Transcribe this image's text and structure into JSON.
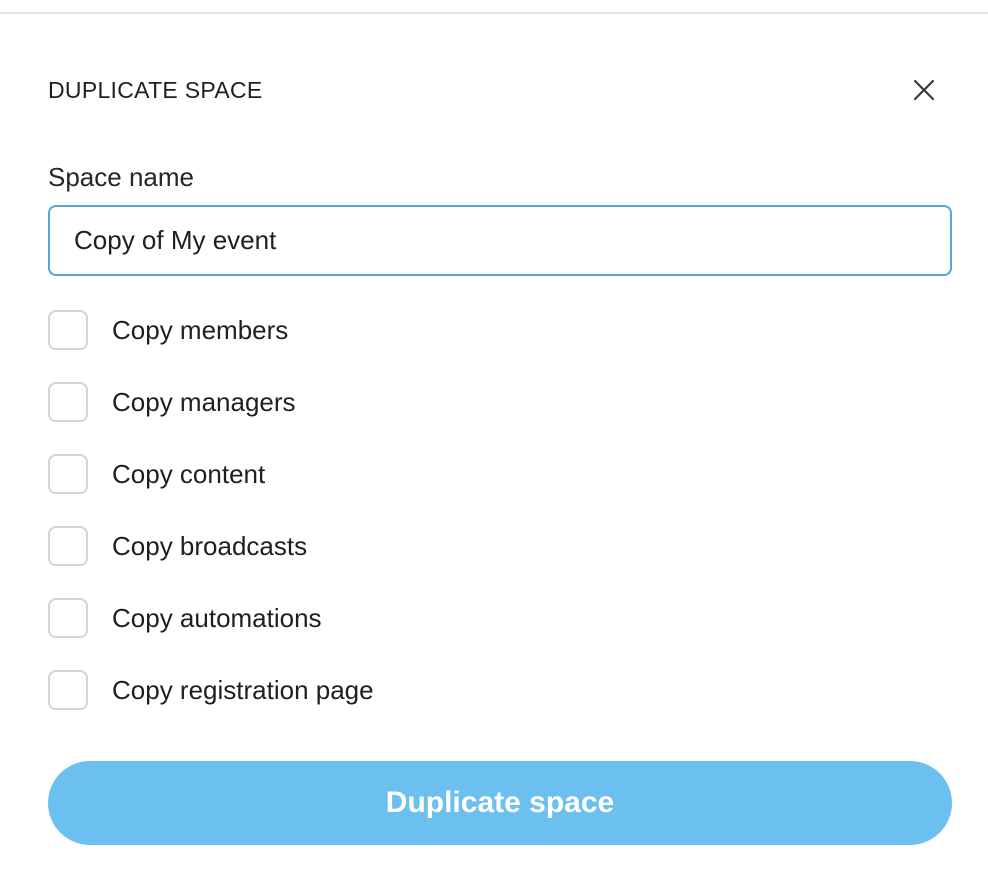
{
  "dialog": {
    "title": "DUPLICATE SPACE",
    "close_icon": "close-icon"
  },
  "form": {
    "space_name_label": "Space name",
    "space_name_value": "Copy of My event"
  },
  "options": [
    {
      "label": "Copy members",
      "checked": false
    },
    {
      "label": "Copy managers",
      "checked": false
    },
    {
      "label": "Copy content",
      "checked": false
    },
    {
      "label": "Copy broadcasts",
      "checked": false
    },
    {
      "label": "Copy automations",
      "checked": false
    },
    {
      "label": "Copy registration page",
      "checked": false
    }
  ],
  "submit": {
    "label": "Duplicate space",
    "enabled": false
  },
  "colors": {
    "accent_disabled": "#6cc0ef",
    "input_focus_border": "#58a6d6",
    "checkbox_border": "#d5d5d5"
  }
}
